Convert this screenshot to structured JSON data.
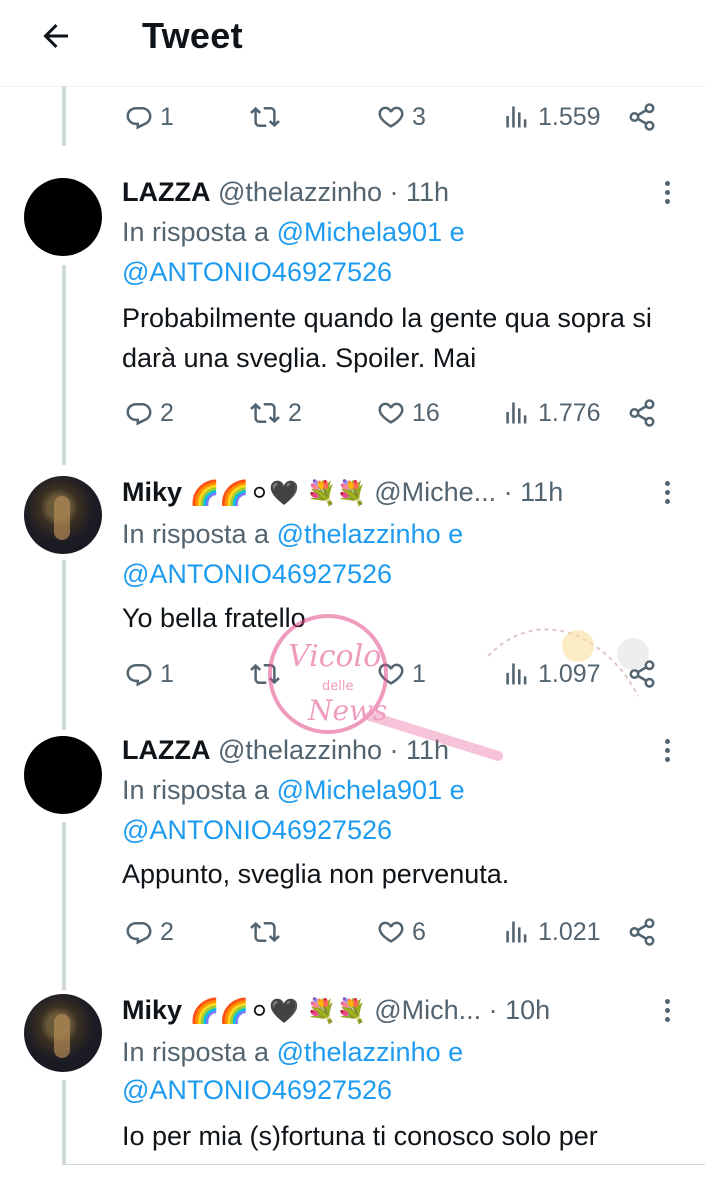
{
  "header": {
    "title": "Tweet",
    "back_icon": "arrow-left-icon"
  },
  "top_actions": {
    "replies": "1",
    "retweets": "",
    "likes": "3",
    "views": "1.559"
  },
  "tweets": [
    {
      "name": "LAZZA",
      "handle": "@thelazzinho",
      "time": "· 11h",
      "reply_prefix": "In risposta a",
      "reply_user1": "@Michela901",
      "reply_and": "e",
      "reply_user2": "@ANTONIO46927526",
      "text": "Probabilmente quando la gente qua sopra si darà una sveglia. Spoiler. Mai",
      "replies": "2",
      "retweets": "2",
      "likes": "16",
      "views": "1.776"
    },
    {
      "name": "Miky",
      "emojis": "🌈🌈⚪🖤 💐💐",
      "handle": "@Miche...",
      "time": "· 11h",
      "reply_prefix": "In risposta a",
      "reply_user1": "@thelazzinho",
      "reply_and": "e",
      "reply_user2": "@ANTONIO46927526",
      "text": "Yo bella fratello",
      "replies": "1",
      "retweets": "",
      "likes": "1",
      "views": "1.097"
    },
    {
      "name": "LAZZA",
      "handle": "@thelazzinho",
      "time": "· 11h",
      "reply_prefix": "In risposta a",
      "reply_user1": "@Michela901",
      "reply_and": "e",
      "reply_user2": "@ANTONIO46927526",
      "text": "Appunto, sveglia non pervenuta.",
      "replies": "2",
      "retweets": "",
      "likes": "6",
      "views": "1.021"
    },
    {
      "name": "Miky",
      "emojis": "🌈🌈⚪🖤 💐💐",
      "handle": "@Mich...",
      "time": "· 10h",
      "reply_prefix": "In risposta a",
      "reply_user1": "@thelazzinho",
      "reply_and": "e",
      "reply_user2": "@ANTONIO46927526",
      "text": "Io per mia (s)fortuna ti conosco solo per"
    }
  ],
  "watermark": {
    "line1": "Vicolo",
    "line2": "delle",
    "line3": "News"
  },
  "colors": {
    "link": "#1d9bf0",
    "secondary": "#536471",
    "text": "#0f1419",
    "thread_line": "#cfd9de"
  }
}
